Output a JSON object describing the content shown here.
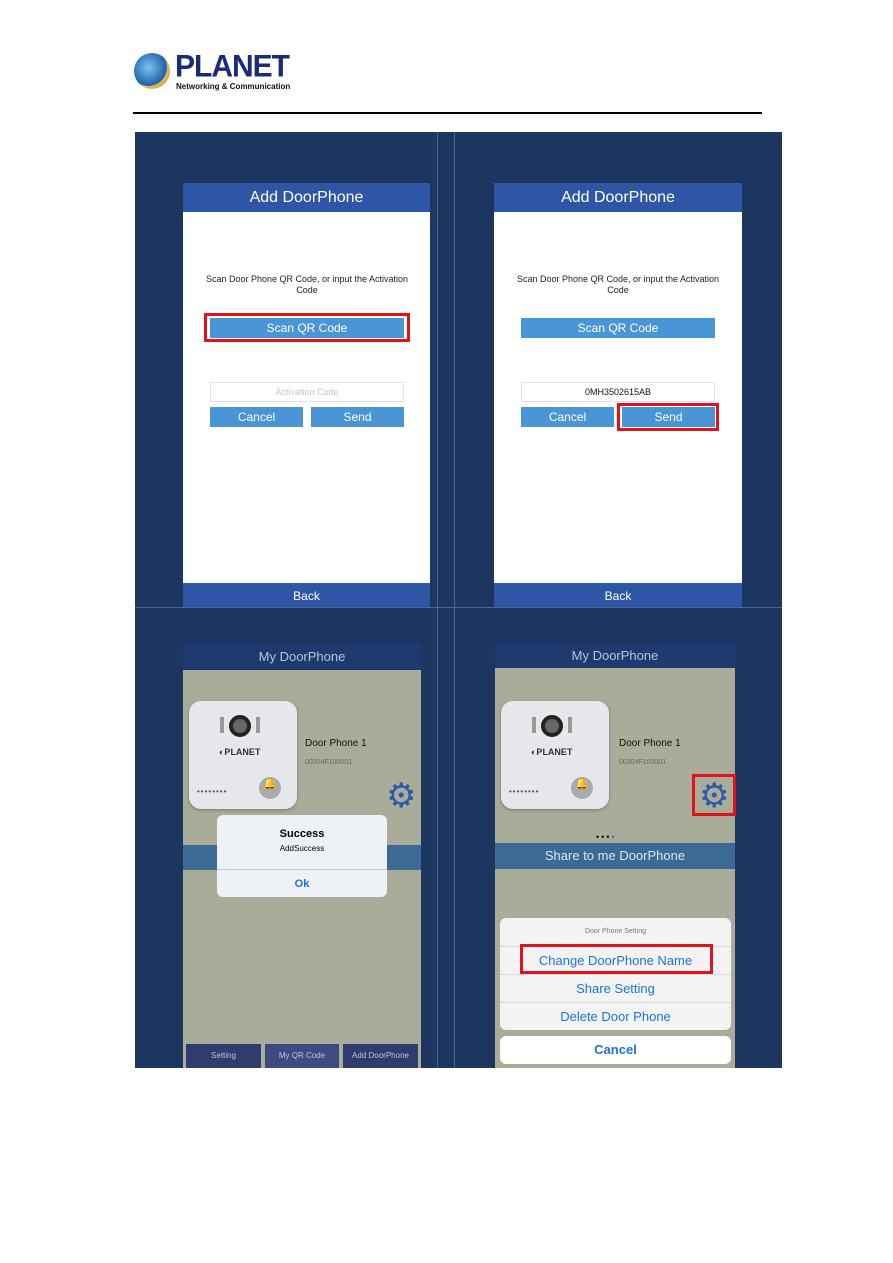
{
  "header": {
    "brand": "PLANET",
    "tagline": "Networking & Communication"
  },
  "screen1": {
    "title": "Add DoorPhone",
    "prompt": "Scan Door Phone QR Code, or input the Activation Code",
    "scan": "Scan QR Code",
    "activation_placeholder": "Activation Code",
    "cancel": "Cancel",
    "send": "Send",
    "back": "Back"
  },
  "screen2": {
    "title": "Add DoorPhone",
    "prompt": "Scan Door Phone QR Code, or input the Activation Code",
    "scan": "Scan QR Code",
    "activation_value": "0MH3502615AB",
    "cancel": "Cancel",
    "send": "Send",
    "back": "Back"
  },
  "screen3": {
    "title": "My DoorPhone",
    "device_name": "Door Phone 1",
    "device_id": "00304F100001",
    "dialog": {
      "title": "Success",
      "message": "AddSuccess",
      "ok": "Ok"
    },
    "tabs": [
      "Setting",
      "My QR Code",
      "Add DoorPhone"
    ]
  },
  "screen4": {
    "title": "My DoorPhone",
    "device_name": "Door Phone 1",
    "device_id": "00304F100001",
    "band": "Share to me DoorPhone",
    "sheet": {
      "title": "Door Phone Setting",
      "items": [
        "Change DoorPhone Name",
        "Share Setting",
        "Delete Door Phone"
      ],
      "cancel": "Cancel"
    }
  },
  "colors": {
    "highlight": "#e0121c",
    "accent": "#2f56a6"
  }
}
